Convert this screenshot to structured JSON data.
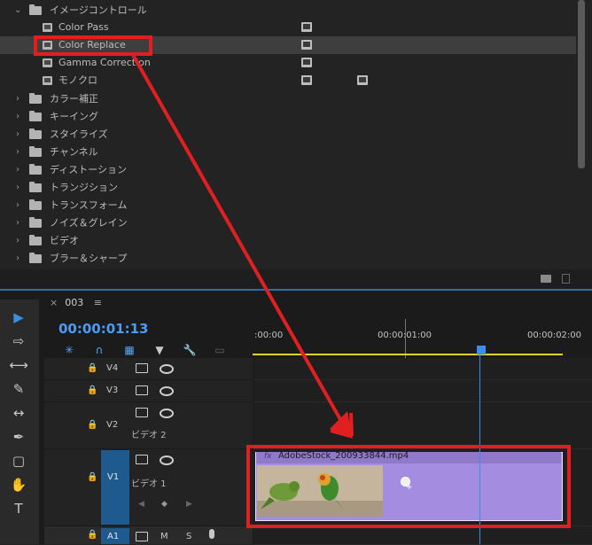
{
  "effects_panel": {
    "folder_open": "イメージコントロール",
    "items": [
      "Color Pass",
      "Color Replace",
      "Gamma Correction",
      "モノクロ"
    ],
    "folders": [
      "カラー補正",
      "キーイング",
      "スタイライズ",
      "チャンネル",
      "ディストーション",
      "トランジション",
      "トランスフォーム",
      "ノイズ＆グレイン",
      "ビデオ",
      "ブラー＆シャープ"
    ]
  },
  "timeline": {
    "close_glyph": "×",
    "sequence_tab": "003",
    "menu_glyph": "≡",
    "timecode": "00:00:01:13",
    "ruler_ticks": [
      ":00:00",
      "00:00:01:00",
      "00:00:02:00"
    ],
    "tracks": {
      "v4": "V4",
      "v3": "V3",
      "v2": "V2",
      "v2_sub": "ビデオ 2",
      "v1": "V1",
      "v1_sub": "ビデオ 1",
      "a1": "A1",
      "a1_target": "A1",
      "m": "M",
      "s": "S"
    },
    "clip_fx": "fx",
    "clip_name": "AdobeStock_200933844.mp4"
  },
  "colors": {
    "accent": "#3b8ddf",
    "clip": "#a48de0",
    "highlight": "#e02020"
  }
}
